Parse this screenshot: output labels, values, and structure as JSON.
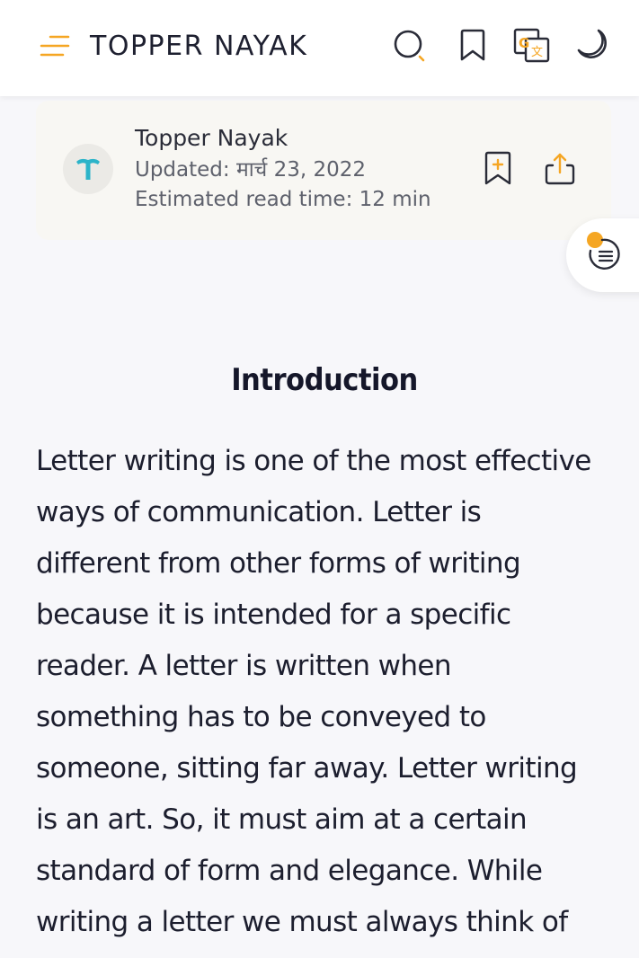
{
  "header": {
    "site_title": "TOPPER NAYAK",
    "icons": [
      "menu-icon",
      "search-icon",
      "bookmark-icon",
      "translate-icon",
      "dark-mode-icon"
    ],
    "accent_color": "#f5a623"
  },
  "post_meta": {
    "avatar_letter": "T",
    "author": "Topper Nayak",
    "updated": "Updated: मार्च 23, 2022",
    "read_time": "Estimated read time: 12 min",
    "actions": [
      "add-bookmark-icon",
      "share-icon"
    ]
  },
  "toc": {
    "icon": "table-of-contents-icon"
  },
  "article": {
    "section_title": "Introduction",
    "body_lines": [
      "Letter writing is one of the most effective",
      "ways of communication. Letter is",
      "different from other forms of writing",
      "because it is intended for a specific",
      "reader. A letter is written when",
      "something has to be conveyed to",
      "someone, sitting far away. Letter writing",
      "is an art. So, it must aim at a certain",
      "standard of form and elegance. While",
      "writing a letter we must always think of"
    ]
  },
  "colors": {
    "accent": "#f5a623",
    "avatar_letter": "#2cb4c9",
    "text": "#1c1e2e",
    "muted_text": "#5e616c"
  }
}
